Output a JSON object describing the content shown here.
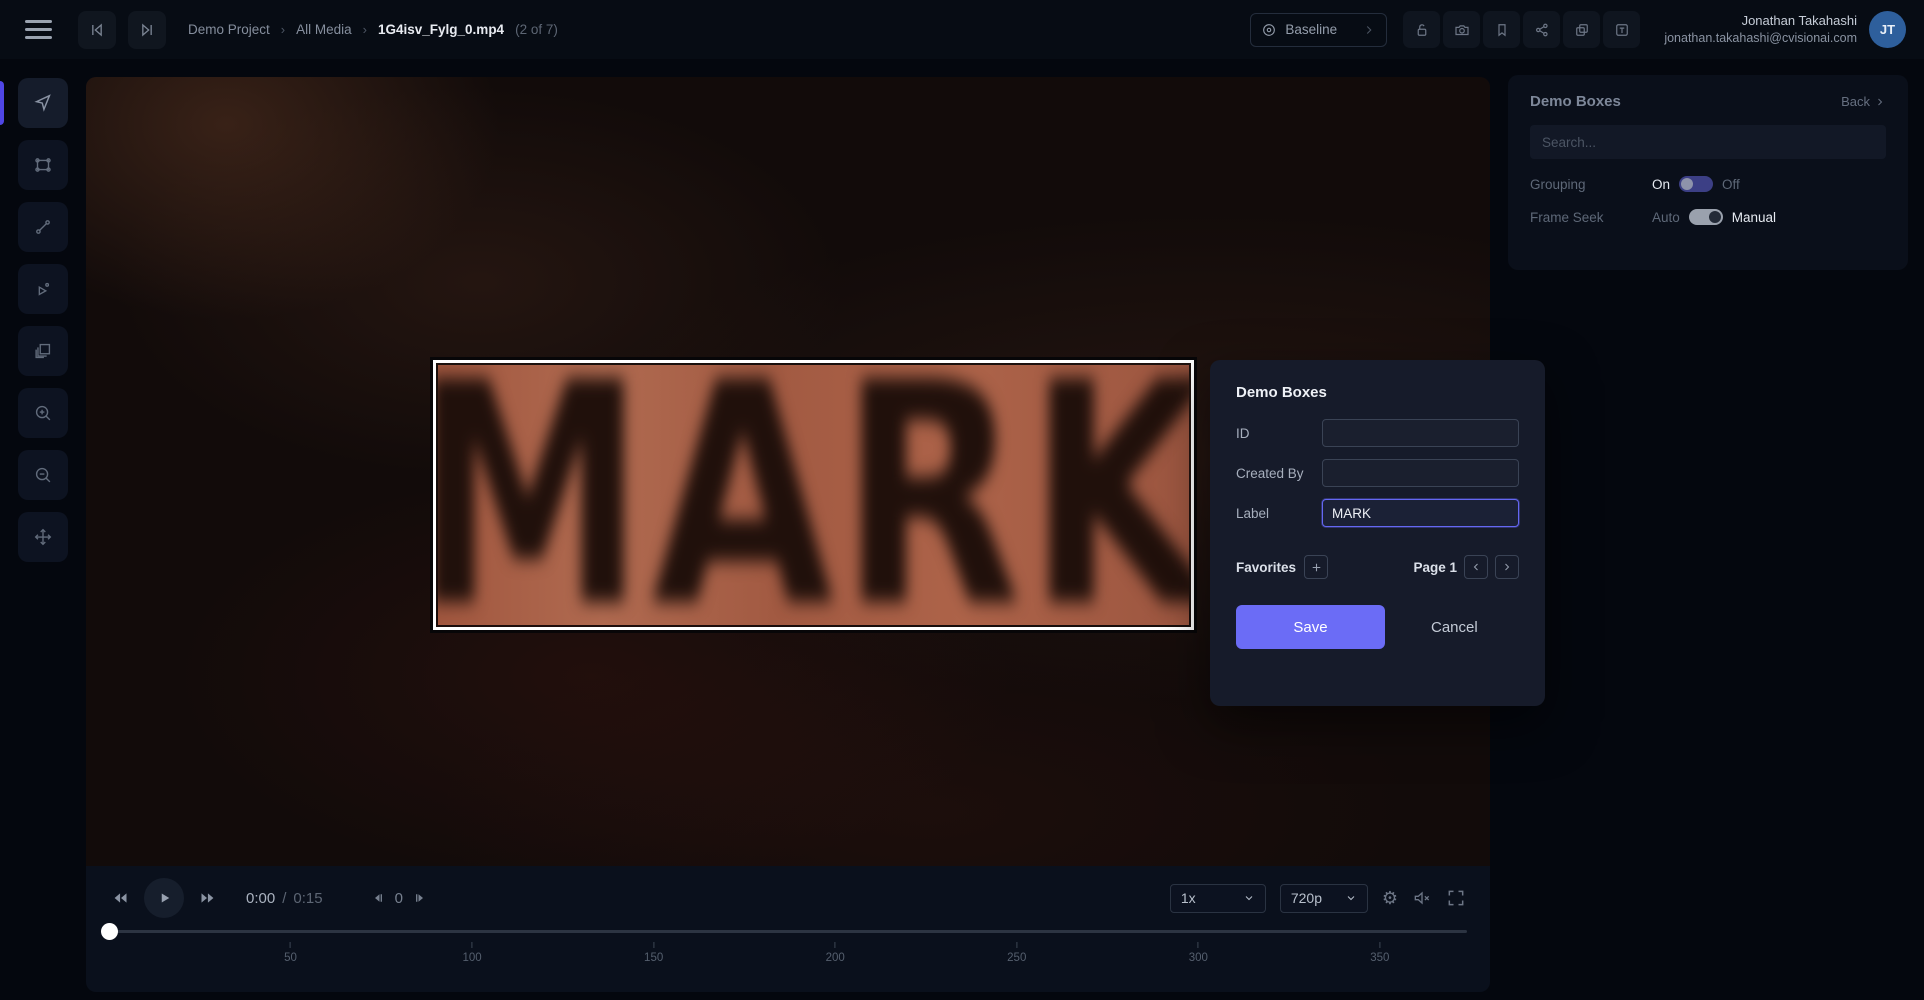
{
  "header": {
    "breadcrumb": {
      "project": "Demo Project",
      "sep": "›",
      "section": "All Media",
      "file": "1G4isv_Fylg_0.mp4",
      "count": "(2 of 7)"
    },
    "version_selector": {
      "label": "Baseline"
    },
    "user": {
      "name": "Jonathan Takahashi",
      "email": "jonathan.takahashi@cvisionai.com",
      "initials": "JT"
    }
  },
  "toolbar": {
    "tools": [
      "pointer",
      "box",
      "line",
      "point",
      "layers",
      "zoom-in",
      "zoom-out",
      "pan"
    ],
    "active_tool": "pointer"
  },
  "video": {
    "bbox_label": "MARK"
  },
  "player": {
    "current_time": "0:00",
    "time_separator": "/",
    "duration": "0:15",
    "frame_number": "0",
    "playback_rate": "1x",
    "quality": "720p"
  },
  "timeline": {
    "ticks": [
      50,
      100,
      150,
      200,
      250,
      300,
      350
    ],
    "range_max": 374,
    "position": 0
  },
  "sidebar": {
    "title": "Demo Boxes",
    "back_label": "Back",
    "search_placeholder": "Search...",
    "grouping": {
      "label": "Grouping",
      "on_label": "On",
      "off_label": "Off",
      "state": "on"
    },
    "frame_seek": {
      "label": "Frame Seek",
      "auto_label": "Auto",
      "manual_label": "Manual",
      "state": "manual"
    }
  },
  "modal": {
    "title": "Demo Boxes",
    "fields": [
      {
        "label": "ID",
        "value": ""
      },
      {
        "label": "Created By",
        "value": ""
      },
      {
        "label": "Label",
        "value": "MARK"
      }
    ],
    "favorites_label": "Favorites",
    "page_label": "Page 1",
    "save_label": "Save",
    "cancel_label": "Cancel"
  },
  "colors": {
    "accent": "#6b6cf6",
    "avatar": "#2e5f9c",
    "bbox_stroke": "#ffffff"
  }
}
